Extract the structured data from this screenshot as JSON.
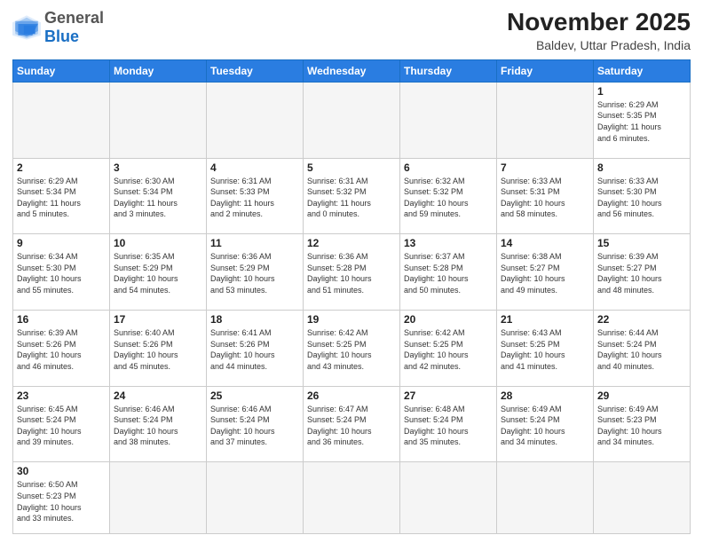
{
  "header": {
    "logo_general": "General",
    "logo_blue": "Blue",
    "month_year": "November 2025",
    "location": "Baldev, Uttar Pradesh, India"
  },
  "weekdays": [
    "Sunday",
    "Monday",
    "Tuesday",
    "Wednesday",
    "Thursday",
    "Friday",
    "Saturday"
  ],
  "weeks": [
    [
      {
        "day": "",
        "info": ""
      },
      {
        "day": "",
        "info": ""
      },
      {
        "day": "",
        "info": ""
      },
      {
        "day": "",
        "info": ""
      },
      {
        "day": "",
        "info": ""
      },
      {
        "day": "",
        "info": ""
      },
      {
        "day": "1",
        "info": "Sunrise: 6:29 AM\nSunset: 5:35 PM\nDaylight: 11 hours\nand 6 minutes."
      }
    ],
    [
      {
        "day": "2",
        "info": "Sunrise: 6:29 AM\nSunset: 5:34 PM\nDaylight: 11 hours\nand 5 minutes."
      },
      {
        "day": "3",
        "info": "Sunrise: 6:30 AM\nSunset: 5:34 PM\nDaylight: 11 hours\nand 3 minutes."
      },
      {
        "day": "4",
        "info": "Sunrise: 6:31 AM\nSunset: 5:33 PM\nDaylight: 11 hours\nand 2 minutes."
      },
      {
        "day": "5",
        "info": "Sunrise: 6:31 AM\nSunset: 5:32 PM\nDaylight: 11 hours\nand 0 minutes."
      },
      {
        "day": "6",
        "info": "Sunrise: 6:32 AM\nSunset: 5:32 PM\nDaylight: 10 hours\nand 59 minutes."
      },
      {
        "day": "7",
        "info": "Sunrise: 6:33 AM\nSunset: 5:31 PM\nDaylight: 10 hours\nand 58 minutes."
      },
      {
        "day": "8",
        "info": "Sunrise: 6:33 AM\nSunset: 5:30 PM\nDaylight: 10 hours\nand 56 minutes."
      }
    ],
    [
      {
        "day": "9",
        "info": "Sunrise: 6:34 AM\nSunset: 5:30 PM\nDaylight: 10 hours\nand 55 minutes."
      },
      {
        "day": "10",
        "info": "Sunrise: 6:35 AM\nSunset: 5:29 PM\nDaylight: 10 hours\nand 54 minutes."
      },
      {
        "day": "11",
        "info": "Sunrise: 6:36 AM\nSunset: 5:29 PM\nDaylight: 10 hours\nand 53 minutes."
      },
      {
        "day": "12",
        "info": "Sunrise: 6:36 AM\nSunset: 5:28 PM\nDaylight: 10 hours\nand 51 minutes."
      },
      {
        "day": "13",
        "info": "Sunrise: 6:37 AM\nSunset: 5:28 PM\nDaylight: 10 hours\nand 50 minutes."
      },
      {
        "day": "14",
        "info": "Sunrise: 6:38 AM\nSunset: 5:27 PM\nDaylight: 10 hours\nand 49 minutes."
      },
      {
        "day": "15",
        "info": "Sunrise: 6:39 AM\nSunset: 5:27 PM\nDaylight: 10 hours\nand 48 minutes."
      }
    ],
    [
      {
        "day": "16",
        "info": "Sunrise: 6:39 AM\nSunset: 5:26 PM\nDaylight: 10 hours\nand 46 minutes."
      },
      {
        "day": "17",
        "info": "Sunrise: 6:40 AM\nSunset: 5:26 PM\nDaylight: 10 hours\nand 45 minutes."
      },
      {
        "day": "18",
        "info": "Sunrise: 6:41 AM\nSunset: 5:26 PM\nDaylight: 10 hours\nand 44 minutes."
      },
      {
        "day": "19",
        "info": "Sunrise: 6:42 AM\nSunset: 5:25 PM\nDaylight: 10 hours\nand 43 minutes."
      },
      {
        "day": "20",
        "info": "Sunrise: 6:42 AM\nSunset: 5:25 PM\nDaylight: 10 hours\nand 42 minutes."
      },
      {
        "day": "21",
        "info": "Sunrise: 6:43 AM\nSunset: 5:25 PM\nDaylight: 10 hours\nand 41 minutes."
      },
      {
        "day": "22",
        "info": "Sunrise: 6:44 AM\nSunset: 5:24 PM\nDaylight: 10 hours\nand 40 minutes."
      }
    ],
    [
      {
        "day": "23",
        "info": "Sunrise: 6:45 AM\nSunset: 5:24 PM\nDaylight: 10 hours\nand 39 minutes."
      },
      {
        "day": "24",
        "info": "Sunrise: 6:46 AM\nSunset: 5:24 PM\nDaylight: 10 hours\nand 38 minutes."
      },
      {
        "day": "25",
        "info": "Sunrise: 6:46 AM\nSunset: 5:24 PM\nDaylight: 10 hours\nand 37 minutes."
      },
      {
        "day": "26",
        "info": "Sunrise: 6:47 AM\nSunset: 5:24 PM\nDaylight: 10 hours\nand 36 minutes."
      },
      {
        "day": "27",
        "info": "Sunrise: 6:48 AM\nSunset: 5:24 PM\nDaylight: 10 hours\nand 35 minutes."
      },
      {
        "day": "28",
        "info": "Sunrise: 6:49 AM\nSunset: 5:24 PM\nDaylight: 10 hours\nand 34 minutes."
      },
      {
        "day": "29",
        "info": "Sunrise: 6:49 AM\nSunset: 5:23 PM\nDaylight: 10 hours\nand 34 minutes."
      }
    ],
    [
      {
        "day": "30",
        "info": "Sunrise: 6:50 AM\nSunset: 5:23 PM\nDaylight: 10 hours\nand 33 minutes."
      },
      {
        "day": "",
        "info": ""
      },
      {
        "day": "",
        "info": ""
      },
      {
        "day": "",
        "info": ""
      },
      {
        "day": "",
        "info": ""
      },
      {
        "day": "",
        "info": ""
      },
      {
        "day": "",
        "info": ""
      }
    ]
  ]
}
